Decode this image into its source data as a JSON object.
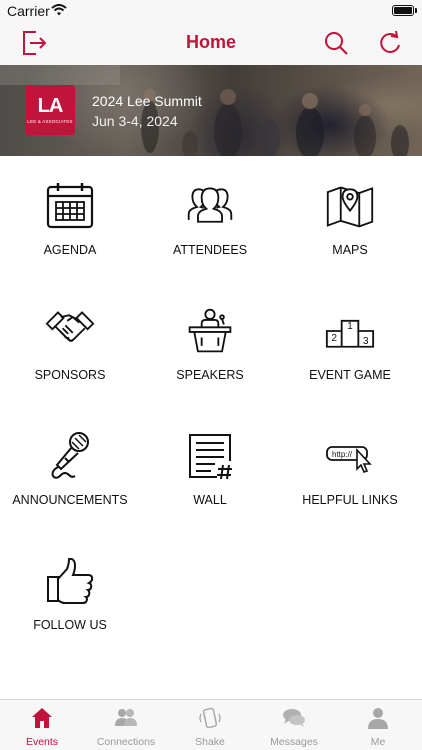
{
  "status_bar": {
    "carrier": "Carrier"
  },
  "nav": {
    "title": "Home"
  },
  "banner": {
    "logo_mark": "LA",
    "logo_sub": "LEE & ASSOCIATES",
    "event_name": "2024 Lee Summit",
    "event_date": "Jun 3-4, 2024"
  },
  "tiles": [
    {
      "label": "AGENDA",
      "icon": "calendar-icon"
    },
    {
      "label": "ATTENDEES",
      "icon": "people-icon"
    },
    {
      "label": "MAPS",
      "icon": "map-icon"
    },
    {
      "label": "SPONSORS",
      "icon": "handshake-icon"
    },
    {
      "label": "SPEAKERS",
      "icon": "podium-icon"
    },
    {
      "label": "EVENT GAME",
      "icon": "leaderboard-icon"
    },
    {
      "label": "ANNOUNCEMENTS",
      "icon": "microphone-icon"
    },
    {
      "label": "WALL",
      "icon": "wall-post-icon"
    },
    {
      "label": "HELPFUL LINKS",
      "icon": "link-cursor-icon"
    },
    {
      "label": "FOLLOW US",
      "icon": "thumbs-up-icon"
    }
  ],
  "link_icon_text": "http://",
  "podium_places": {
    "first": "1",
    "second": "2",
    "third": "3"
  },
  "tabs": [
    {
      "label": "Events",
      "icon": "home-icon",
      "active": true
    },
    {
      "label": "Connections",
      "icon": "connections-icon",
      "active": false
    },
    {
      "label": "Shake",
      "icon": "shake-phone-icon",
      "active": false
    },
    {
      "label": "Messages",
      "icon": "messages-icon",
      "active": false
    },
    {
      "label": "Me",
      "icon": "person-icon",
      "active": false
    }
  ],
  "colors": {
    "accent": "#c1143a",
    "inactive": "#9a9a9a",
    "bar_bg": "#f7f7f7"
  }
}
